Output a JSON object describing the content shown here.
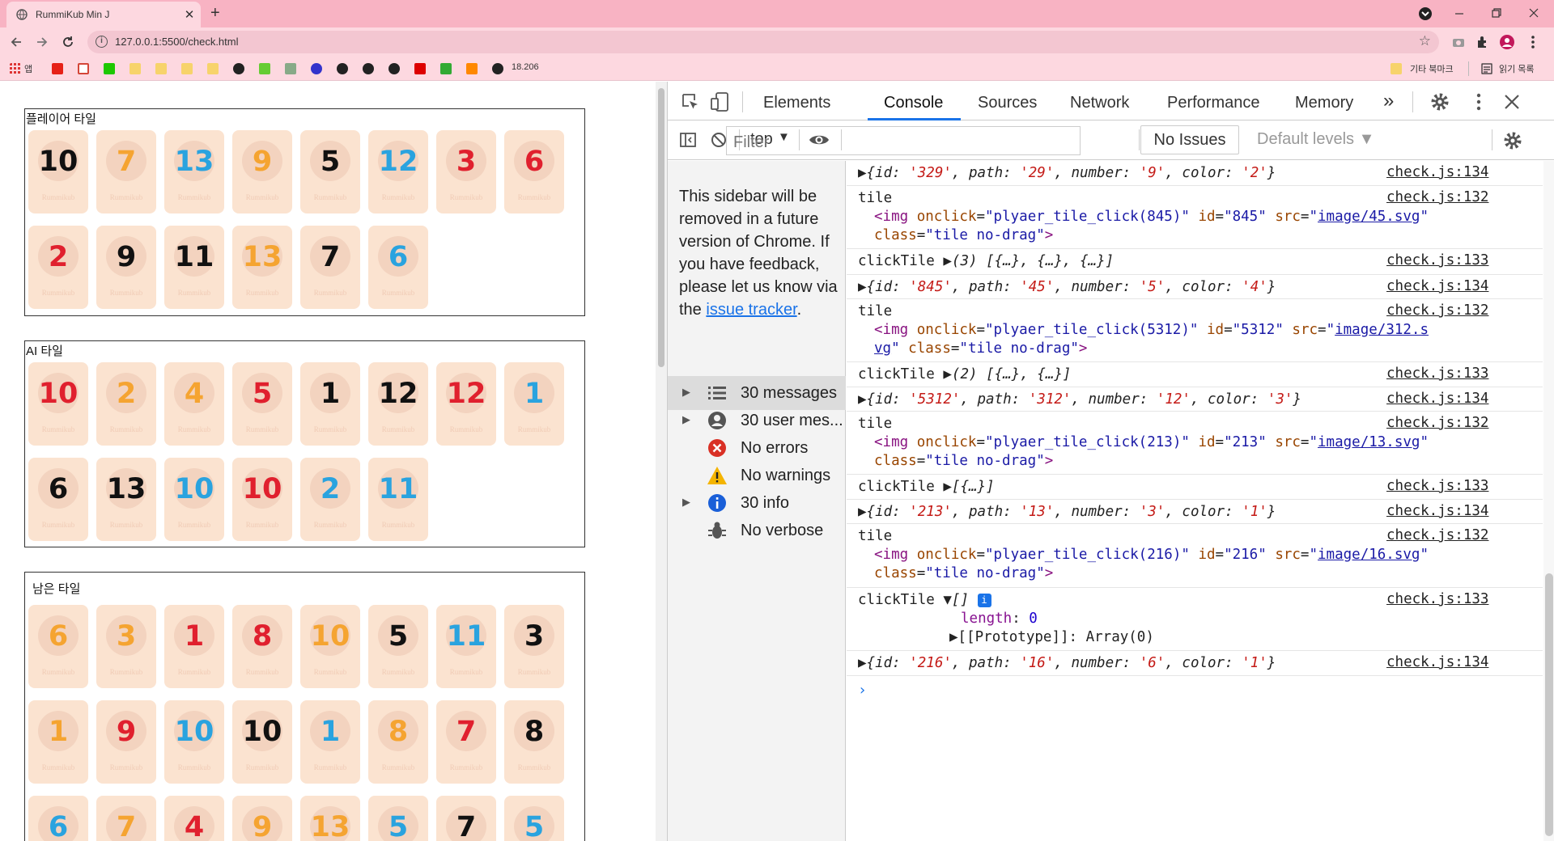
{
  "browser": {
    "tab_title": "RummiKub Min J",
    "tab_close": "✕",
    "new_tab": "+",
    "url": "127.0.0.1:5500/check.html",
    "bookmarks": {
      "apps_label": "앱",
      "ip_label": "18.206",
      "other_bookmarks": "기타 북마크",
      "reading_list": "읽기 목록"
    }
  },
  "page": {
    "sections": [
      {
        "title": "플레이어 타일",
        "tiles": [
          {
            "n": "10",
            "c": "black"
          },
          {
            "n": "7",
            "c": "orange"
          },
          {
            "n": "13",
            "c": "blue"
          },
          {
            "n": "9",
            "c": "orange"
          },
          {
            "n": "5",
            "c": "black"
          },
          {
            "n": "12",
            "c": "blue"
          },
          {
            "n": "3",
            "c": "red"
          },
          {
            "n": "6",
            "c": "red"
          },
          {
            "n": "2",
            "c": "red"
          },
          {
            "n": "9",
            "c": "black"
          },
          {
            "n": "11",
            "c": "black"
          },
          {
            "n": "13",
            "c": "orange"
          },
          {
            "n": "7",
            "c": "black"
          },
          {
            "n": "6",
            "c": "blue"
          }
        ]
      },
      {
        "title": "AI 타일",
        "tiles": [
          {
            "n": "10",
            "c": "red"
          },
          {
            "n": "2",
            "c": "orange"
          },
          {
            "n": "4",
            "c": "orange"
          },
          {
            "n": "5",
            "c": "red"
          },
          {
            "n": "1",
            "c": "black"
          },
          {
            "n": "12",
            "c": "black"
          },
          {
            "n": "12",
            "c": "red"
          },
          {
            "n": "1",
            "c": "blue"
          },
          {
            "n": "6",
            "c": "black"
          },
          {
            "n": "13",
            "c": "black"
          },
          {
            "n": "10",
            "c": "blue"
          },
          {
            "n": "10",
            "c": "red"
          },
          {
            "n": "2",
            "c": "blue"
          },
          {
            "n": "11",
            "c": "blue"
          }
        ]
      },
      {
        "title": "남은 타일",
        "tiles": [
          {
            "n": "6",
            "c": "orange"
          },
          {
            "n": "3",
            "c": "orange"
          },
          {
            "n": "1",
            "c": "red"
          },
          {
            "n": "8",
            "c": "red"
          },
          {
            "n": "10",
            "c": "orange"
          },
          {
            "n": "5",
            "c": "black"
          },
          {
            "n": "11",
            "c": "blue"
          },
          {
            "n": "3",
            "c": "black"
          },
          {
            "n": "1",
            "c": "orange"
          },
          {
            "n": "9",
            "c": "red"
          },
          {
            "n": "10",
            "c": "blue"
          },
          {
            "n": "10",
            "c": "black"
          },
          {
            "n": "1",
            "c": "blue"
          },
          {
            "n": "8",
            "c": "orange"
          },
          {
            "n": "7",
            "c": "red"
          },
          {
            "n": "8",
            "c": "black"
          },
          {
            "n": "6",
            "c": "blue"
          },
          {
            "n": "7",
            "c": "orange"
          },
          {
            "n": "4",
            "c": "red"
          },
          {
            "n": "9",
            "c": "orange"
          },
          {
            "n": "13",
            "c": "orange"
          },
          {
            "n": "5",
            "c": "blue"
          },
          {
            "n": "7",
            "c": "black"
          },
          {
            "n": "5",
            "c": "blue"
          }
        ]
      }
    ],
    "tile_watermark": "Rummikub"
  },
  "devtools": {
    "tabs": [
      "Elements",
      "Console",
      "Sources",
      "Network",
      "Performance",
      "Memory"
    ],
    "active_tab": "Console",
    "more_tabs": "»",
    "context": "top",
    "filter_placeholder": "Filter",
    "levels": "Default levels",
    "no_issues": "No Issues",
    "sidebar_note_text": "This sidebar will be removed in a future version of Chrome. If you have feedback, please let us know via the",
    "sidebar_note_link": "issue tracker",
    "sidebar_items": [
      {
        "label": "30 messages",
        "icon": "list-icon",
        "arrow": true
      },
      {
        "label": "30 user mes...",
        "icon": "user-icon",
        "arrow": true
      },
      {
        "label": "No errors",
        "icon": "error-icon",
        "arrow": false
      },
      {
        "label": "No warnings",
        "icon": "warning-icon",
        "arrow": false
      },
      {
        "label": "30 info",
        "icon": "info-icon",
        "arrow": true
      },
      {
        "label": "No verbose",
        "icon": "bug-icon",
        "arrow": false
      }
    ],
    "console_src": {
      "s132": "check.js:132",
      "s133": "check.js:133",
      "s134": "check.js:134"
    },
    "tile_entries": [
      {
        "id": "845",
        "src": "image/45.svg"
      },
      {
        "id": "5312",
        "src_a": "image/312.s",
        "src_b": "vg"
      },
      {
        "id": "213",
        "src": "image/13.svg"
      },
      {
        "id": "216",
        "src": "image/16.svg"
      }
    ],
    "objects": [
      {
        "id": "'329'",
        "path": "'29'",
        "number": "'9'",
        "color": "'2'"
      },
      {
        "id": "'845'",
        "path": "'45'",
        "number": "'5'",
        "color": "'4'"
      },
      {
        "id": "'5312'",
        "path": "'312'",
        "number": "'12'",
        "color": "'3'"
      },
      {
        "id": "'213'",
        "path": "'13'",
        "number": "'3'",
        "color": "'1'"
      },
      {
        "id": "'216'",
        "path": "'16'",
        "number": "'6'",
        "color": "'1'"
      }
    ],
    "clicktile_label": "clickTile",
    "tile_label": "tile",
    "clicktile_values": [
      "(3) [{…}, {…}, {…}]",
      "(2) [{…}, {…}]",
      "[{…}]",
      "[]"
    ],
    "length_key": "length",
    "length_val": "0",
    "proto_key": "[[Prototype]]",
    "proto_val": "Array(0)"
  },
  "colors": {
    "chrome_pink": "#f8b3c3",
    "accent": "#1a73e8",
    "tile_bg": "#fbe3d0",
    "red": "#e0202e",
    "orange": "#f5a431",
    "blue": "#2aa3df",
    "black": "#111111"
  }
}
